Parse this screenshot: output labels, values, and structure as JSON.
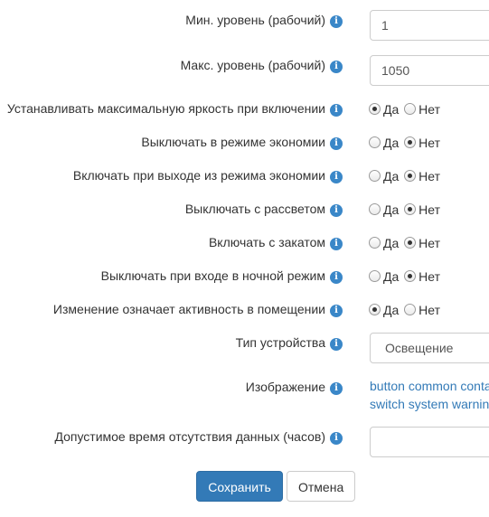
{
  "fields": {
    "min_level": {
      "label": "Мин. уровень (рабочий)",
      "value": "1"
    },
    "max_level": {
      "label": "Макс. уровень (рабочий)",
      "value": "1050"
    },
    "device_type": {
      "label": "Тип устройства",
      "value": "Освещение"
    },
    "image": {
      "label": "Изображение",
      "options": [
        "button common conta",
        "switch system warnin"
      ]
    },
    "timeout": {
      "label": "Допустимое время отсутствия данных (часов)",
      "value": ""
    }
  },
  "radio_options": {
    "yes": "Да",
    "no": "Нет"
  },
  "toggles": [
    {
      "label": "Устанавливать максимальную яркость при включении",
      "selected": "yes"
    },
    {
      "label": "Выключать в режиме экономии",
      "selected": "no"
    },
    {
      "label": "Включать при выходе из режима экономии",
      "selected": "no"
    },
    {
      "label": "Выключать с рассветом",
      "selected": "no"
    },
    {
      "label": "Включать с закатом",
      "selected": "no"
    },
    {
      "label": "Выключать при входе в ночной режим",
      "selected": "no"
    },
    {
      "label": "Изменение означает активность в помещении",
      "selected": "yes"
    }
  ],
  "info_glyph": "i",
  "buttons": {
    "save": "Сохранить",
    "cancel": "Отмена"
  },
  "colors": {
    "accent": "#337ab7",
    "info_icon": "#3a87c8",
    "border": "#cccccc"
  }
}
